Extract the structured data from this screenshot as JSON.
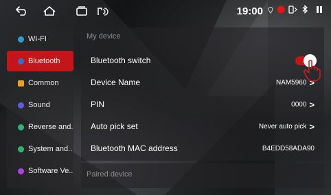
{
  "status_bar": {
    "nav_icons": [
      "back-icon",
      "home-icon",
      "recent-apps-icon",
      "car-link-icon"
    ],
    "time": "19:00",
    "indicators": [
      "location-icon",
      "record-icon",
      "bluetooth-device-icon",
      "bluetooth-icon",
      "pause-icon"
    ],
    "record_color": "#e0161c"
  },
  "sidebar": {
    "items": [
      {
        "label": "WI-FI",
        "icon": "wifi-icon",
        "color": "#2a9fd6"
      },
      {
        "label": "Bluetooth",
        "icon": "bluetooth-icon",
        "color": "#2f6fd6",
        "active": true
      },
      {
        "label": "Common",
        "icon": "common-settings-icon",
        "color": "#f0a020"
      },
      {
        "label": "Sound",
        "icon": "sound-icon",
        "color": "#5b5fe0"
      },
      {
        "label": "Reverse and..",
        "icon": "reverse-icon",
        "color": "#2bb673"
      },
      {
        "label": "System and..",
        "icon": "system-icon",
        "color": "#2bb673"
      },
      {
        "label": "Software Ve..",
        "icon": "software-icon",
        "color": "#b040e0"
      }
    ]
  },
  "main": {
    "section_title": "My device",
    "rows": [
      {
        "label": "Bluetooth switch",
        "toggle_on": true
      },
      {
        "label": "Device Name",
        "value": "NAM5960",
        "chevron": ">"
      },
      {
        "label": "PIN",
        "value": "0000",
        "chevron": ">"
      },
      {
        "label": "Auto pick set",
        "value": "Never auto pick",
        "chevron": ">"
      },
      {
        "label": "Bluetooth MAC address",
        "value": "B4EDD58ADA90"
      }
    ],
    "paired_section_title": "Paired device"
  },
  "colors": {
    "accent": "#c3151a"
  }
}
